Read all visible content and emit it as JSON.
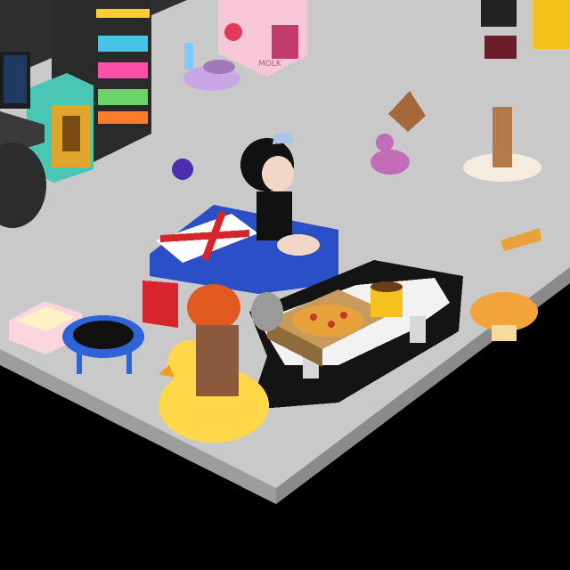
{
  "room": {
    "floor_color": "#c8c8c8",
    "floor_edge_color": "#9a9a9a",
    "void_color": "#000000",
    "wall_color": "#3a3a3a"
  },
  "furniture": {
    "pet_carrier_text": "MOLK"
  },
  "avatars": [
    {
      "name": "girl-with-tiara",
      "seated_on": "union-jack-sofa"
    },
    {
      "name": "red-hair-avatar",
      "seated_on": "rubber-duck-chair"
    },
    {
      "name": "partial-avatar-top-right"
    }
  ],
  "colors": {
    "sofa_blue": "#2a4fc7",
    "flag_red": "#d7262b",
    "rug_black": "#141414",
    "duck_yellow": "#ffd84a",
    "table_white": "#f2f2f2",
    "pizza_box": "#c89a5b",
    "pink_carrier": "#f7c8d8"
  }
}
